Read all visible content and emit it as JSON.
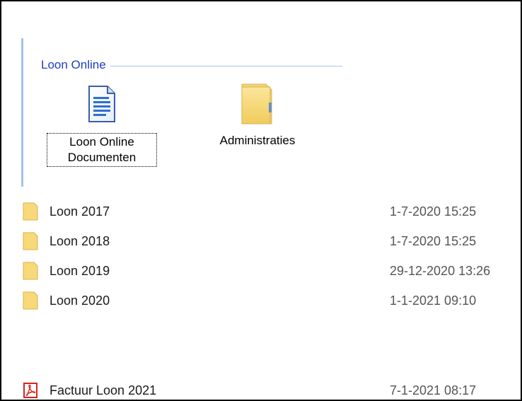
{
  "group": {
    "title": "Loon Online",
    "tiles": [
      {
        "label": "Loon Online\nDocumenten",
        "icon": "document-icon"
      },
      {
        "label": "Administraties",
        "icon": "folder-icon"
      }
    ]
  },
  "files": [
    {
      "name": "Loon 2017",
      "date": "1-7-2020 15:25",
      "icon": "folder-icon"
    },
    {
      "name": "Loon 2018",
      "date": "1-7-2020 15:25",
      "icon": "folder-icon"
    },
    {
      "name": "Loon 2019",
      "date": "29-12-2020 13:26",
      "icon": "folder-icon"
    },
    {
      "name": "Loon 2020",
      "date": "1-1-2021 09:10",
      "icon": "folder-icon"
    },
    {
      "name": "Factuur Loon 2021",
      "date": "7-1-2021 08:17",
      "icon": "pdf-icon"
    }
  ],
  "colors": {
    "group_title": "#1f3fbf",
    "accent_line": "#9fc3ea",
    "folder": "#f7d97a",
    "pdf": "#d9241c",
    "date": "#555555"
  }
}
